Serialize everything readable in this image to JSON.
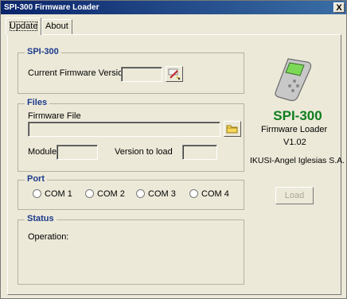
{
  "window": {
    "title": "SPI-300 Firmware Loader",
    "close_label": "X"
  },
  "tabs": [
    {
      "label": "Update"
    },
    {
      "label": "About ..."
    }
  ],
  "spi_group": {
    "title": "SPI-300",
    "current_version_label": "Current Firmware Version",
    "current_version_value": ""
  },
  "files_group": {
    "title": "Files",
    "firmware_file_label": "Firmware File",
    "firmware_file_value": "",
    "module_label": "Module",
    "module_value": "",
    "version_label": "Version to load",
    "version_value": ""
  },
  "port_group": {
    "title": "Port",
    "options": [
      "COM 1",
      "COM 2",
      "COM 3",
      "COM 4"
    ]
  },
  "status_group": {
    "title": "Status",
    "operation_label": "Operation:"
  },
  "brand": {
    "name": "SPI-300",
    "name_color": "#0e7d1f",
    "subtitle": "Firmware Loader",
    "version": "V1.02",
    "company": "IKUSI-Angel Iglesias S.A."
  },
  "load_button": {
    "label": "Load",
    "enabled": false
  }
}
